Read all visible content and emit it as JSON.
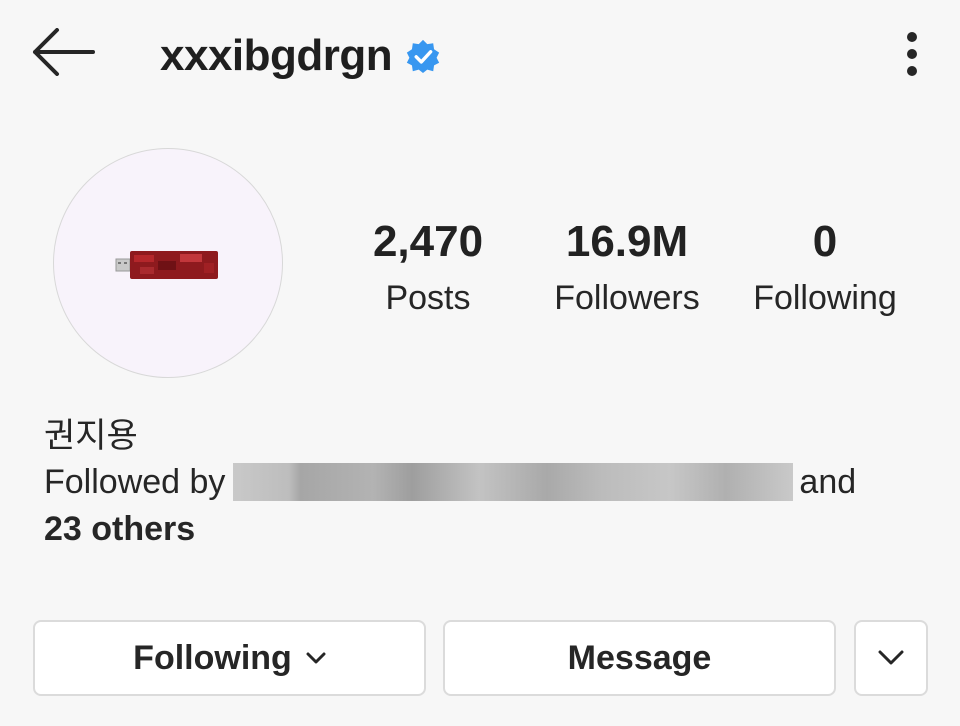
{
  "header": {
    "back_icon": "arrow-left-icon",
    "username": "xxxibgdrgn",
    "verified_icon": "verified-badge-icon",
    "more_icon": "more-vertical-icon"
  },
  "profile": {
    "avatar_desc": "red-usb-drive-image",
    "stats": [
      {
        "value": "2,470",
        "label": "Posts"
      },
      {
        "value": "16.9M",
        "label": "Followers"
      },
      {
        "value": "0",
        "label": "Following"
      }
    ],
    "bio_name": "권지용",
    "followed_by_prefix": "Followed by",
    "followed_by_conjunction": "and",
    "followed_by_others": "23 others"
  },
  "actions": {
    "following_label": "Following",
    "message_label": "Message",
    "dropdown_icon": "chevron-down-icon"
  },
  "colors": {
    "background": "#f7f7f7",
    "text": "#262626",
    "verified": "#3897f0",
    "button_border": "#dbdbdb"
  }
}
